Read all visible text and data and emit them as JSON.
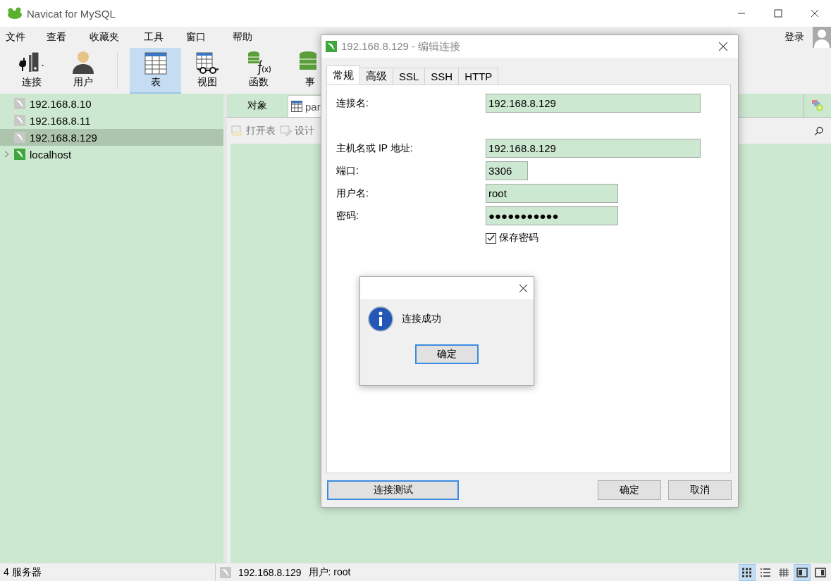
{
  "window": {
    "title": "Navicat for MySQL"
  },
  "menu": [
    "文件",
    "查看",
    "收藏夹",
    "工具",
    "窗口",
    "帮助"
  ],
  "account": {
    "label": "登录"
  },
  "toolbar": [
    {
      "label": "连接",
      "kind": "connect",
      "selected": false
    },
    {
      "label": "用户",
      "kind": "user",
      "selected": false
    },
    {
      "label": "表",
      "kind": "table",
      "selected": true
    },
    {
      "label": "视图",
      "kind": "view",
      "selected": false
    },
    {
      "label": "函数",
      "kind": "function",
      "selected": false
    },
    {
      "label": "事",
      "kind": "event",
      "selected": false
    }
  ],
  "sidebar": {
    "items": [
      {
        "label": "192.168.8.10",
        "connected": false,
        "selected": false,
        "expandable": false
      },
      {
        "label": "192.168.8.11",
        "connected": false,
        "selected": false,
        "expandable": false
      },
      {
        "label": "192.168.8.129",
        "connected": false,
        "selected": true,
        "expandable": false
      },
      {
        "label": "localhost",
        "connected": true,
        "selected": false,
        "expandable": true
      }
    ]
  },
  "object_tabs": {
    "label": "对象",
    "open_tab": "par"
  },
  "object_toolbar": [
    "打开表",
    "设计"
  ],
  "status_bar": {
    "servers": "4 服务器",
    "host": "192.168.8.129",
    "user": "用户: root",
    "views": [
      {
        "kind": "grid",
        "selected": true
      },
      {
        "kind": "list",
        "selected": false
      },
      {
        "kind": "detail",
        "selected": false
      },
      {
        "kind": "panel-left",
        "selected": true
      },
      {
        "kind": "panel-right",
        "selected": false
      }
    ]
  },
  "dialog": {
    "title": "192.168.8.129 - 编辑连接",
    "tabs": [
      {
        "label": "常规",
        "selected": true
      },
      {
        "label": "高级",
        "selected": false
      },
      {
        "label": "SSL",
        "selected": false
      },
      {
        "label": "SSH",
        "selected": false
      },
      {
        "label": "HTTP",
        "selected": false
      }
    ],
    "fields": [
      {
        "label": "连接名:",
        "value": "192.168.8.129"
      },
      {
        "label": "主机名或 IP 地址:",
        "value": "192.168.8.129"
      },
      {
        "label": "端口:",
        "value": "3306"
      },
      {
        "label": "用户名:",
        "value": "root"
      },
      {
        "label": "密码:",
        "value": "●●●●●●●●●●●"
      }
    ],
    "checkbox": {
      "label": "保存密码",
      "checked": true
    },
    "buttons": [
      {
        "label": "连接测试",
        "focused": true
      },
      {
        "label": "确定",
        "focused": false
      },
      {
        "label": "取消",
        "focused": false
      }
    ]
  },
  "message_box": {
    "text": "连接成功",
    "button": "确定"
  }
}
